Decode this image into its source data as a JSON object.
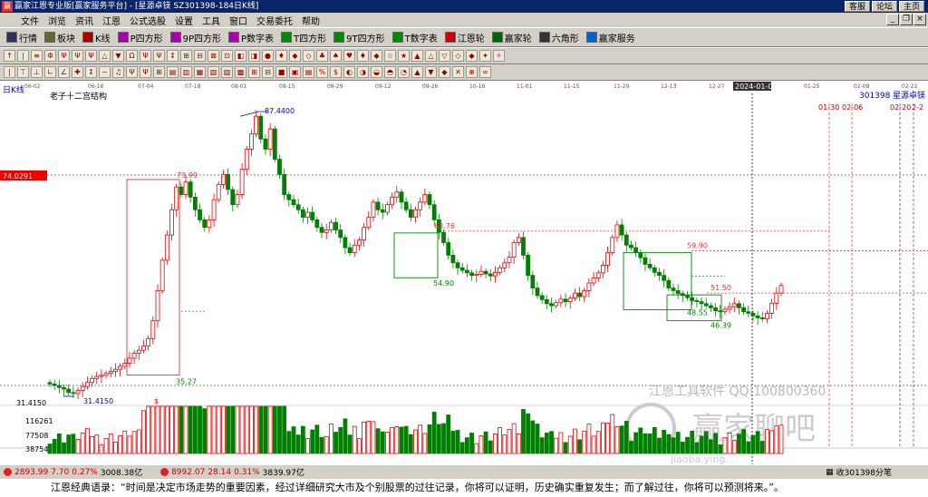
{
  "window": {
    "title": "赢家江恩专业版[赢家服务平台] - [星源卓镁  SZ301398-184日K线]",
    "top_links": [
      "客服",
      "论坛",
      "主页"
    ]
  },
  "menu": [
    "文件",
    "浏览",
    "资讯",
    "江恩",
    "公式选股",
    "设置",
    "工具",
    "窗口",
    "交易委托",
    "帮助"
  ],
  "toolbar1": [
    {
      "label": "行情",
      "icon": "grid-icon",
      "color": "#335"
    },
    {
      "label": "板块",
      "icon": "blocks-icon",
      "color": "#663"
    },
    {
      "label": "K线",
      "icon": "kline-icon",
      "color": "#a00"
    },
    {
      "label": "P四方形",
      "icon": "p-square-icon",
      "color": "#a0a"
    },
    {
      "label": "9P四方形",
      "icon": "9p-square-icon",
      "color": "#a0a"
    },
    {
      "label": "P数字表",
      "icon": "p-table-icon",
      "color": "#a0a"
    },
    {
      "label": "T四方形",
      "icon": "t-square-icon",
      "color": "#080"
    },
    {
      "label": "9T四方形",
      "icon": "9t-square-icon",
      "color": "#080"
    },
    {
      "label": "T数字表",
      "icon": "t-table-icon",
      "color": "#080"
    },
    {
      "label": "江恩轮",
      "icon": "gann-wheel-icon",
      "color": "#c00"
    },
    {
      "label": "赢家轮",
      "icon": "winner-wheel-icon",
      "color": "#060"
    },
    {
      "label": "六角形",
      "icon": "hexagon-icon",
      "color": "#333"
    },
    {
      "label": "赢家服务",
      "icon": "service-icon",
      "color": "#06c"
    }
  ],
  "chart": {
    "period_label": "日K线",
    "study_title": "老子十二宫结构",
    "stock_code": "301398",
    "stock_name": "星源卓镁",
    "date_ticks": [
      "06-02",
      "06-16",
      "07-04",
      "07-18",
      "08-01",
      "08-15",
      "08-29",
      "09-12",
      "09-26",
      "10-16",
      "11-01",
      "11-15",
      "11-29",
      "12-13",
      "12-27",
      "2024-01-08",
      "01-25",
      "02-08",
      "02-22"
    ],
    "highlight_date": "2024-01-08",
    "price_axis_tag": "74.0291",
    "left_axis_price": "31.4150",
    "volume_ticks": [
      "116261",
      "77508",
      "38754"
    ],
    "annotations": {
      "high": "87.4400",
      "low": "31.4150",
      "p7399": "73.99",
      "p3527": "35.27",
      "p6376": "63.76",
      "p5490": "54.90",
      "p5990": "59.90",
      "p5150": "51.50",
      "p4855": "48.55",
      "p4639": "46.39",
      "f01": "01-30",
      "f02": "02-06",
      "f03": "02-20",
      "f04": "2-2"
    },
    "watermark1": "江恩工具软件  QQ:100800360",
    "watermark2": "赢家聊吧",
    "watermark3": "jiaoba.ying..."
  },
  "chart_data": {
    "type": "candlestick",
    "date_range": [
      "2023-06-02",
      "2024-01-15"
    ],
    "ylim": [
      31.415,
      87.44
    ],
    "key_levels": [
      87.44,
      73.99,
      63.76,
      59.9,
      54.9,
      51.5,
      48.55,
      46.39,
      35.27,
      31.415
    ],
    "last_close": 53.0
  },
  "status": {
    "index1": {
      "value": "2893.99",
      "chg": "7.70",
      "pct": "0.27%",
      "amount": "3008.38亿"
    },
    "index2": {
      "value": "8992.07",
      "chg": "28.14",
      "pct": "0.31%",
      "amount": "3839.97亿"
    },
    "right": "收301398分笔"
  },
  "footer": "江恩经典语录：“时间是决定市场走势的重要因素，经过详细研究大市及个别股票的过往记录，你将可以证明，历史确实重复发生；而了解过往，你将可以预测将来。”。"
}
